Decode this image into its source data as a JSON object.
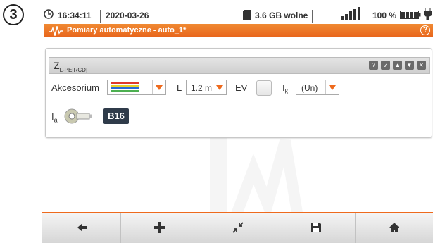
{
  "step_number": "3",
  "status": {
    "time": "16:34:11",
    "date": "2020-03-26",
    "storage": "3.6 GB wolne",
    "battery": "100 %"
  },
  "titlebar": {
    "title": "Pomiary automatyczne - auto_1*",
    "help": "?"
  },
  "panel": {
    "title_main": "Z",
    "title_sub": "L-PE[RCD]",
    "accessory_label": "Akcesorium",
    "l_label": "L",
    "l_value": "1.2 m",
    "ev_label": "EV",
    "ik_label": "I",
    "ik_sub": "k",
    "ik_value": "(Un)",
    "ia_label": "I",
    "ia_sub": "a",
    "equals": "=",
    "fuse": "B16"
  },
  "colors": {
    "accent": "#ee6a1d",
    "fuse_bg": "#2f3b4a"
  },
  "footer_icons": [
    "arrow-left-icon",
    "plus-icon",
    "collapse-icon",
    "save-icon",
    "home-icon"
  ]
}
